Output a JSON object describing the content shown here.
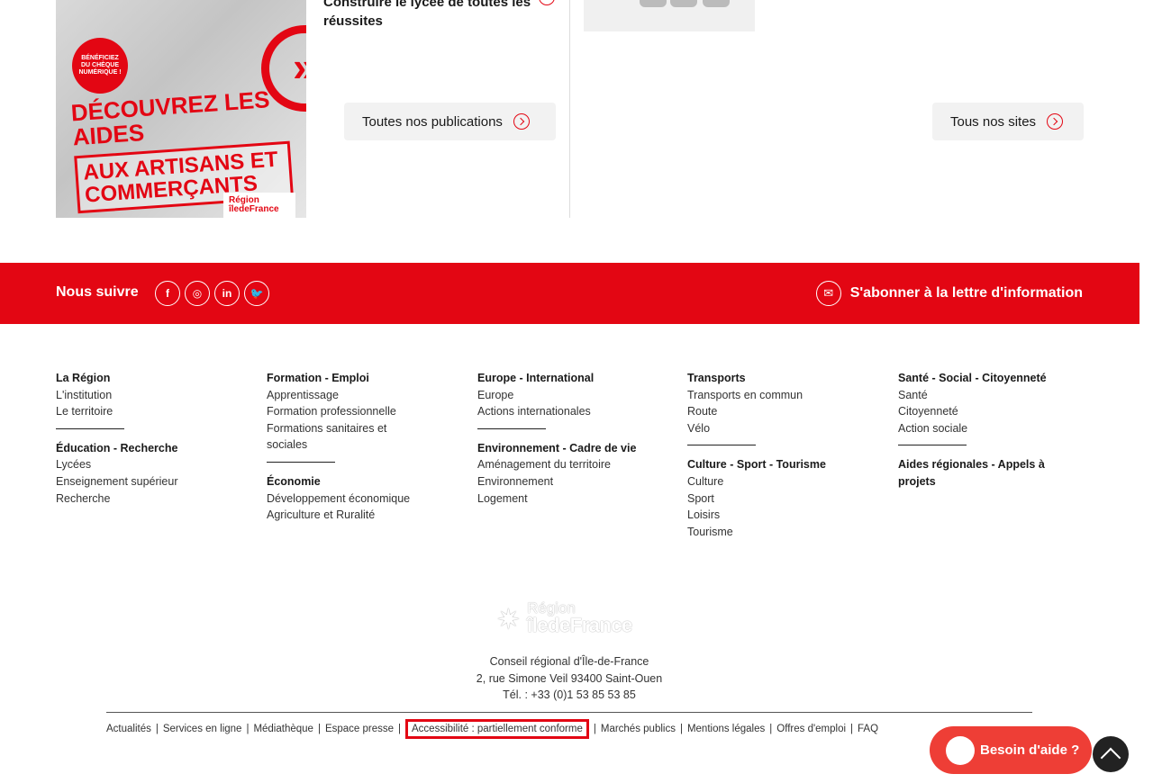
{
  "publication": {
    "poster_badge": "BÉNÉFICIEZ DU CHÈQUE NUMÉRIQUE !",
    "poster_heading": "DÉCOUVREZ LES AIDES",
    "poster_sub": "AUX ARTISANS ET COMMERÇANTS",
    "poster_logo": "Région îledeFrance",
    "title": "Construire le lycée de toutes les réussites",
    "all_button": "Toutes nos publications"
  },
  "sites": {
    "all_button": "Tous nos sites"
  },
  "follow": {
    "label": "Nous suivre",
    "networks": [
      {
        "name": "facebook-icon",
        "glyph": "f"
      },
      {
        "name": "instagram-icon",
        "glyph": "◎"
      },
      {
        "name": "linkedin-icon",
        "glyph": "in"
      },
      {
        "name": "twitter-icon",
        "glyph": "🐦"
      }
    ],
    "newsletter": "S'abonner à la lettre d'information",
    "accent": "#e30613"
  },
  "footer_menu": {
    "col1": {
      "g1_head": "La Région",
      "g1_links": [
        "L'institution",
        "Le territoire"
      ],
      "g2_head": "Éducation - Recherche",
      "g2_links": [
        "Lycées",
        "Enseignement supérieur",
        "Recherche"
      ]
    },
    "col2": {
      "g1_head": "Formation - Emploi",
      "g1_links": [
        "Apprentissage",
        "Formation professionnelle",
        "Formations sanitaires et sociales"
      ],
      "g2_head": "Économie",
      "g2_links": [
        "Développement économique",
        "Agriculture et Ruralité"
      ]
    },
    "col3": {
      "g1_head": "Europe - International",
      "g1_links": [
        "Europe",
        "Actions internationales"
      ],
      "g2_head": "Environnement - Cadre de vie",
      "g2_links": [
        "Aménagement du territoire",
        "Environnement",
        "Logement"
      ]
    },
    "col4": {
      "g1_head": "Transports",
      "g1_links": [
        "Transports en commun",
        "Route",
        "Vélo"
      ],
      "g2_head": "Culture - Sport - Tourisme",
      "g2_links": [
        "Culture",
        "Sport",
        "Loisirs",
        "Tourisme"
      ]
    },
    "col5": {
      "g1_head": "Santé - Social - Citoyenneté",
      "g1_links": [
        "Santé",
        "Citoyenneté",
        "Action sociale"
      ],
      "g2_head": "Aides régionales - Appels à projets"
    }
  },
  "logo": {
    "line1": "Région",
    "line2": "îledeFrance"
  },
  "address": {
    "org": "Conseil régional d'Île-de-France",
    "street": "2, rue Simone Veil 93400 Saint-Ouen",
    "phone": "Tél. : +33 (0)1 53 85 53 85"
  },
  "legal_links": [
    "Actualités",
    "Services en ligne",
    "Médiathèque",
    "Espace presse",
    "Accessibilité : partiellement conforme",
    "Marchés publics",
    "Mentions légales",
    "Offres d'emploi",
    "FAQ"
  ],
  "help_button": "Besoin d'aide ?"
}
